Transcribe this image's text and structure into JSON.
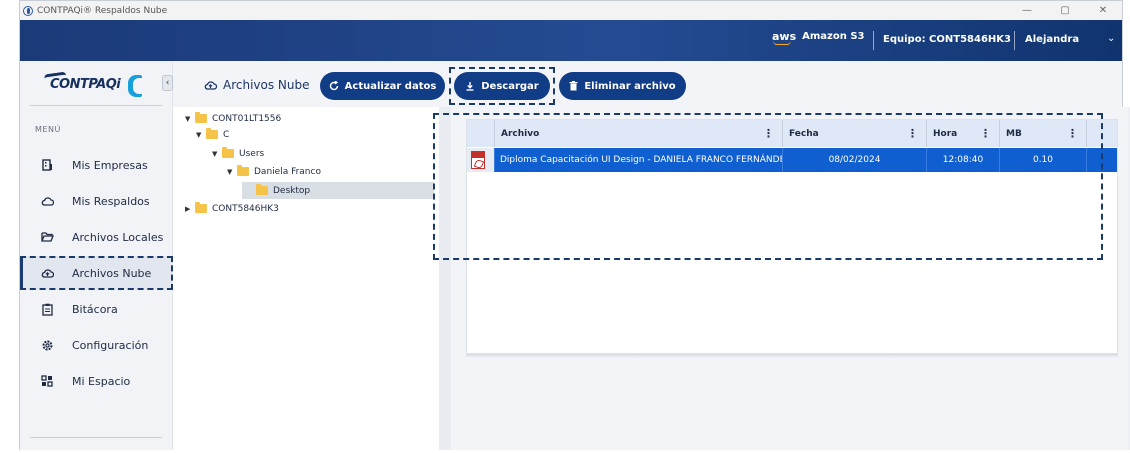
{
  "window": {
    "title": "CONTPAQi® Respaldos Nube",
    "controls": {
      "minimize": "—",
      "restore": "▢",
      "close": "✕"
    }
  },
  "topbar": {
    "aws_logo": "aws",
    "provider": "Amazon S3",
    "equipo": "Equipo: CONT5846HK3",
    "user": "Alejandra",
    "chevron": "⌄"
  },
  "sidebar": {
    "logo_text": "CONTPAQi",
    "collapse_glyph": "‹",
    "menu_label": "MENÚ",
    "items": [
      {
        "label": "Mis Empresas",
        "icon": "building-icon"
      },
      {
        "label": "Mis Respaldos",
        "icon": "cloud-icon"
      },
      {
        "label": "Archivos Locales",
        "icon": "folder-open-icon"
      },
      {
        "label": "Archivos Nube",
        "icon": "cloud-upload-icon",
        "active": true
      },
      {
        "label": "Bitácora",
        "icon": "clipboard-icon"
      },
      {
        "label": "Configuración",
        "icon": "gear-icon"
      },
      {
        "label": "Mi Espacio",
        "icon": "grid-icon"
      }
    ]
  },
  "toolbar": {
    "title": "Archivos Nube",
    "refresh_label": "Actualizar datos",
    "download_label": "Descargar",
    "delete_label": "Eliminar archivo"
  },
  "tree": [
    {
      "label": "CONT01LT1556",
      "toggle": "▼",
      "level": 0
    },
    {
      "label": "C",
      "toggle": "▼",
      "level": 1
    },
    {
      "label": "Users",
      "toggle": "▼",
      "level": 2
    },
    {
      "label": "Daniela Franco",
      "toggle": "▼",
      "level": 3
    },
    {
      "label": "Desktop",
      "toggle": "",
      "level": 4,
      "selected": true
    },
    {
      "label": "CONT5846HK3",
      "toggle": "▶",
      "level": 0
    }
  ],
  "grid": {
    "columns": [
      "Archivo",
      "Fecha",
      "Hora",
      "MB"
    ],
    "rows": [
      {
        "archivo": "Diploma Capacitación UI Design - DANIELA FRANCO FERNÁNDEZ",
        "fecha": "08/02/2024",
        "hora": "12:08:40",
        "mb": "0.10"
      }
    ]
  },
  "colors": {
    "primary": "#113c86",
    "selection": "#0f5fd1",
    "header": "#dfe8f6",
    "aws_accent": "#f7a928"
  }
}
